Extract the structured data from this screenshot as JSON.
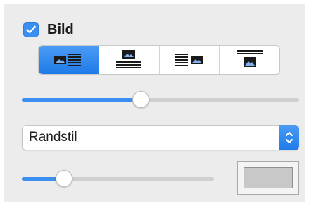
{
  "image_section": {
    "enabled": true,
    "label": "Bild"
  },
  "wrap_options": {
    "items": [
      {
        "icon": "image-left-text-right-icon",
        "selected": true
      },
      {
        "icon": "image-above-text-icon",
        "selected": false
      },
      {
        "icon": "text-left-image-right-icon",
        "selected": false
      },
      {
        "icon": "text-above-image-icon",
        "selected": false
      }
    ]
  },
  "size_slider": {
    "value_fraction": 0.43
  },
  "border_style": {
    "selected": "Randstil"
  },
  "border_width_slider": {
    "value_fraction": 0.22
  },
  "border_color": {
    "color": "#c8c8c8"
  },
  "colors": {
    "accent": "#3b8ff1",
    "panel_bg": "#ececec"
  }
}
